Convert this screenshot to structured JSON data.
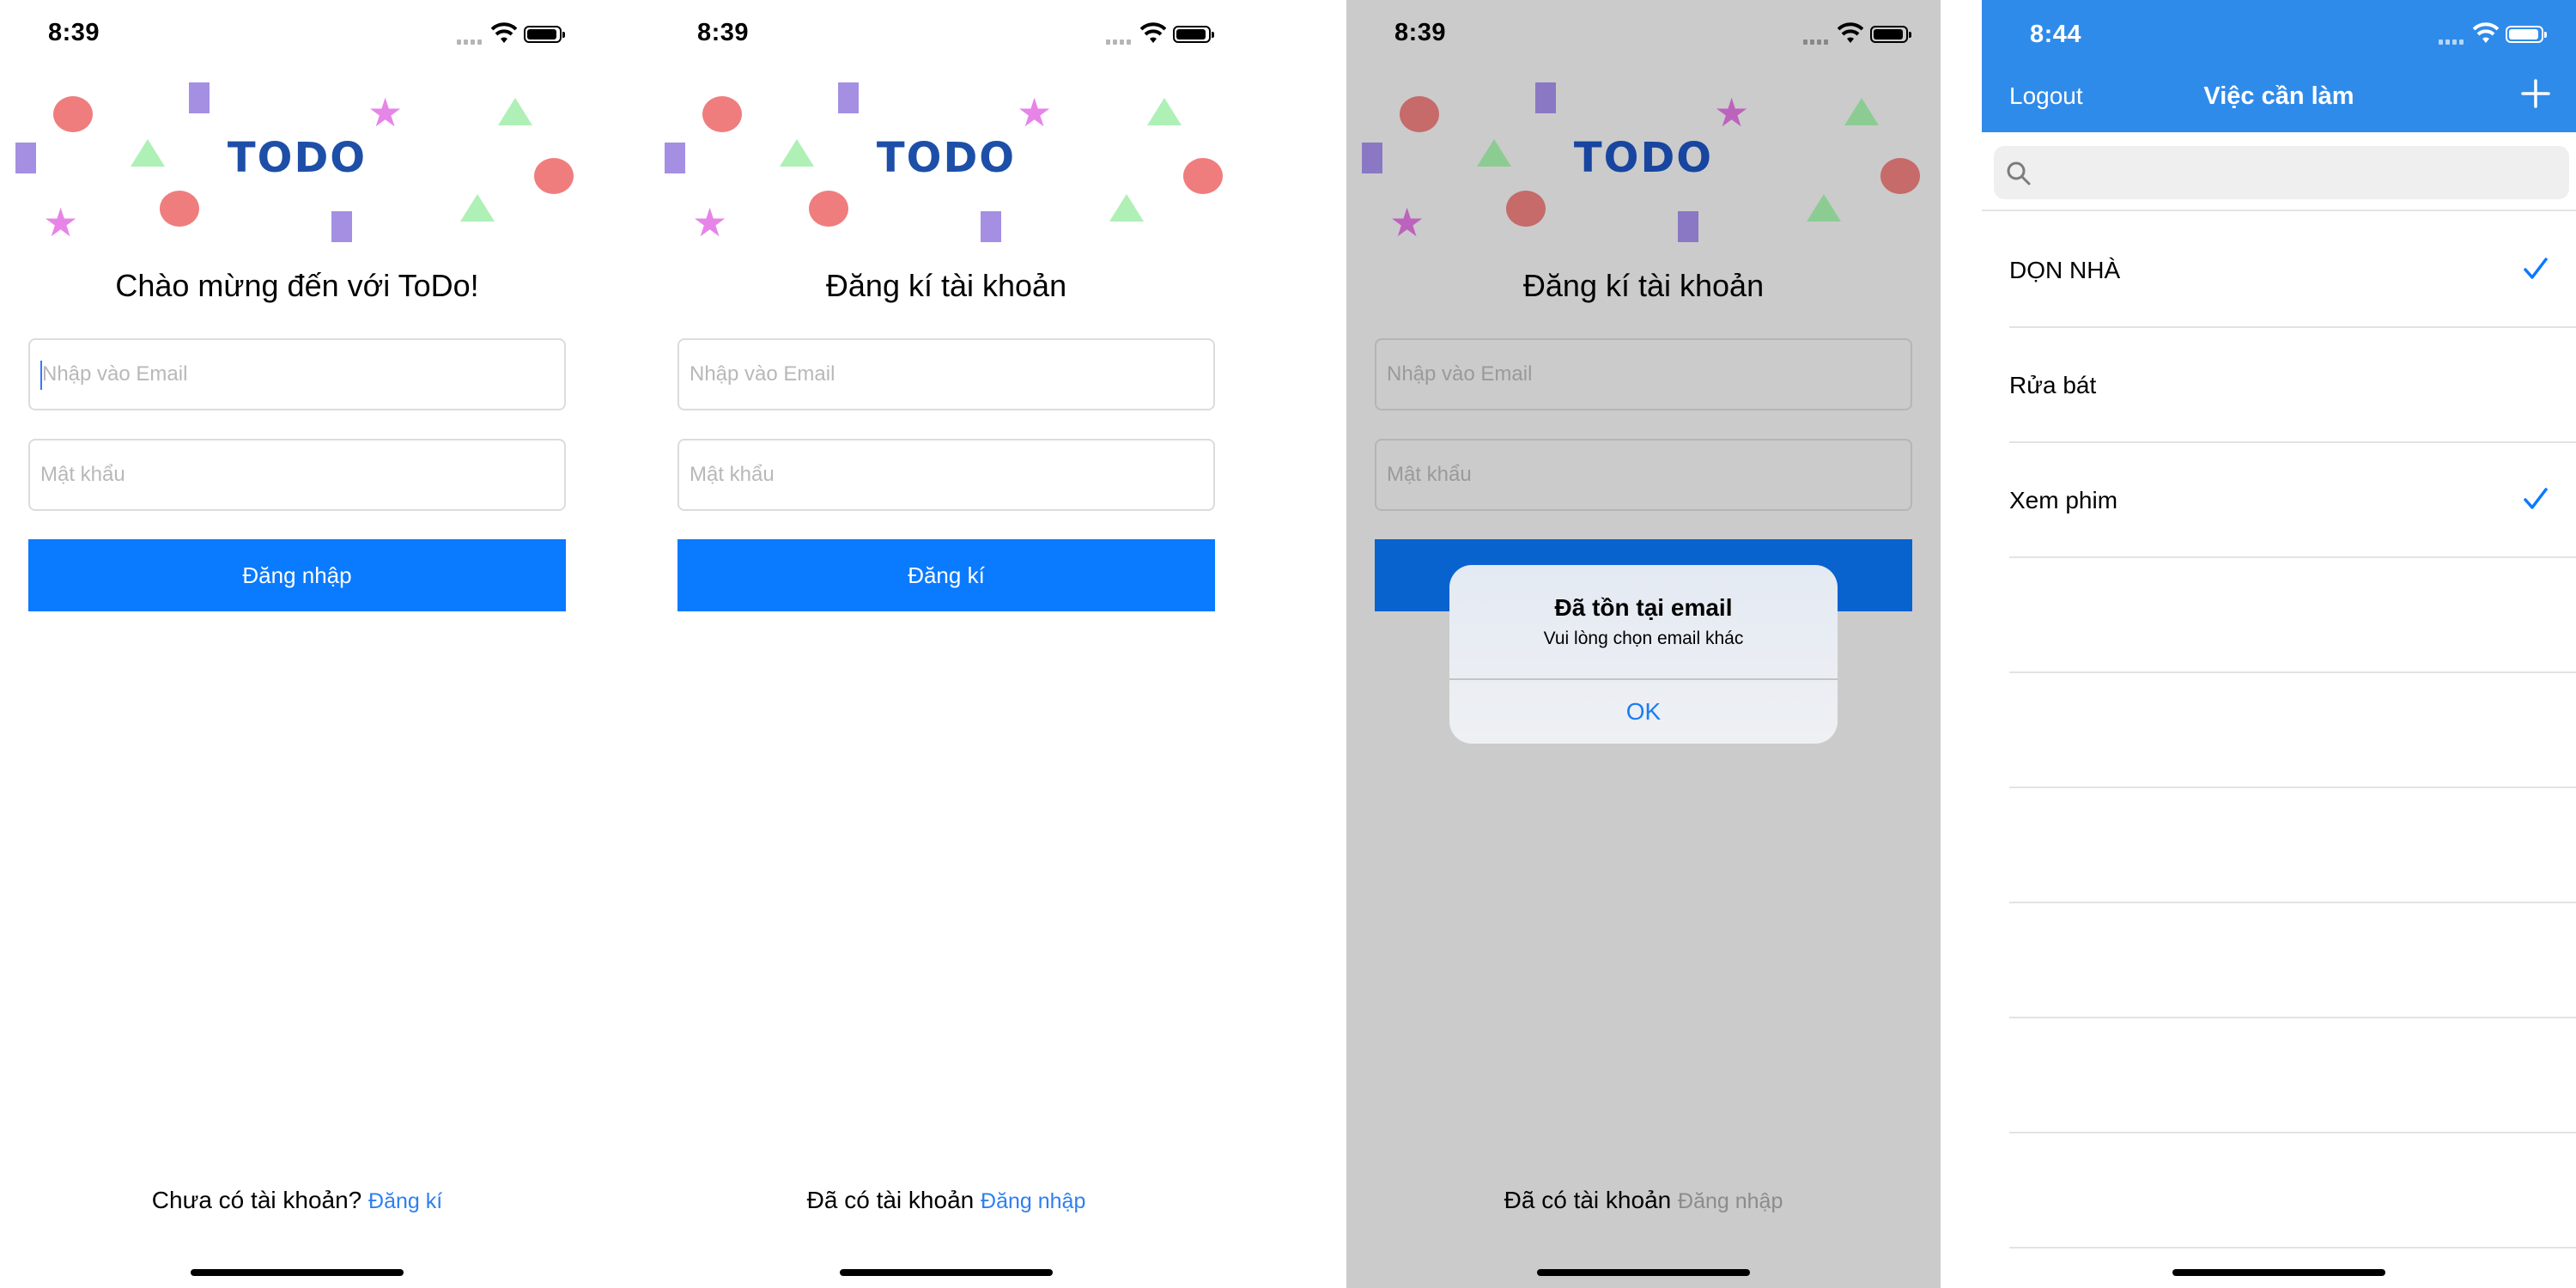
{
  "status_bar": {
    "screen1_time": "8:39",
    "screen2_time": "8:39",
    "screen3_time": "8:39",
    "screen4_time": "8:44"
  },
  "banner": {
    "logo": "TODO"
  },
  "login": {
    "heading": "Chào mừng đến với ToDo!",
    "email_placeholder": "Nhập vào Email",
    "password_placeholder": "Mật khẩu",
    "submit_label": "Đăng nhập",
    "footer_text": "Chưa có tài khoản?",
    "footer_link": "Đăng kí"
  },
  "register": {
    "heading": "Đăng kí tài khoản",
    "email_placeholder": "Nhập vào Email",
    "password_placeholder": "Mật khẩu",
    "submit_label": "Đăng kí",
    "footer_text": "Đã có tài khoản",
    "footer_link": "Đăng nhập"
  },
  "alert": {
    "title": "Đã tồn tại email",
    "message": "Vui lòng chọn email khác",
    "ok_label": "OK"
  },
  "todo_list": {
    "nav_left": "Logout",
    "title": "Việc cần làm",
    "add_icon": "plus-icon",
    "search_icon": "search-icon",
    "search_value": "",
    "items": [
      {
        "label": "DỌN NHÀ",
        "checked": true
      },
      {
        "label": "Rửa bát",
        "checked": false
      },
      {
        "label": "Xem phim",
        "checked": true
      }
    ],
    "empty_rows": 6
  },
  "colors": {
    "accent": "#0a7aff",
    "nav_bar": "#2f8bea",
    "logo": "#1d4fa8",
    "overlay": "#cbcbcb"
  }
}
